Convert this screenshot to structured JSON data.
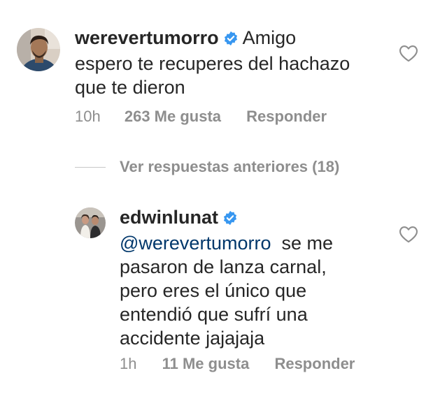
{
  "comment": {
    "username": "werevertumorro",
    "text": "Amigo espero te recuperes del hachazo que te dieron",
    "time": "10h",
    "likes": "263 Me gusta",
    "reply_label": "Responder"
  },
  "view_replies": {
    "label": "Ver respuestas anteriores (18)"
  },
  "reply": {
    "username": "edwinlunat",
    "mention": "@werevertumorro",
    "text": "se me pasaron de lanza carnal, pero eres el único que entendió que sufrí una accidente jajajaja",
    "time": "1h",
    "likes": "11 Me gusta",
    "reply_label": "Responder"
  },
  "colors": {
    "verified_badge": "#3897f0",
    "mention": "#00376b",
    "secondary_text": "#8e8e8e"
  },
  "icons": {
    "verified": "verified-badge-icon",
    "like": "heart-outline-icon"
  }
}
